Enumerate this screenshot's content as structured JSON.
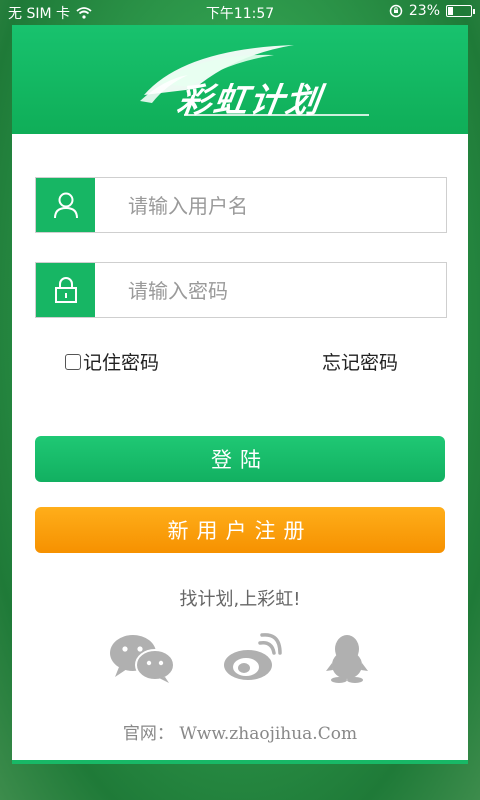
{
  "status_bar": {
    "carrier": "无 SIM 卡",
    "time": "下午11:57",
    "battery_text": "23%",
    "battery_level": 0.23
  },
  "header": {
    "logo_text": "彩虹计划"
  },
  "login_form": {
    "username_placeholder": "请输入用户名",
    "password_placeholder": "请输入密码",
    "remember_label": "记住密码",
    "forgot_label": "忘记密码",
    "login_button": "登陆",
    "register_button": "新用户注册"
  },
  "footer": {
    "slogan": "找计划,上彩虹!",
    "social_icons": [
      "wechat-icon",
      "weibo-icon",
      "qq-icon"
    ],
    "website": "官网： Www.zhaojihua.Com"
  },
  "colors": {
    "primary_green": "#17b664",
    "register_orange": "#f69100",
    "icon_gray": "#b0b0b0"
  }
}
